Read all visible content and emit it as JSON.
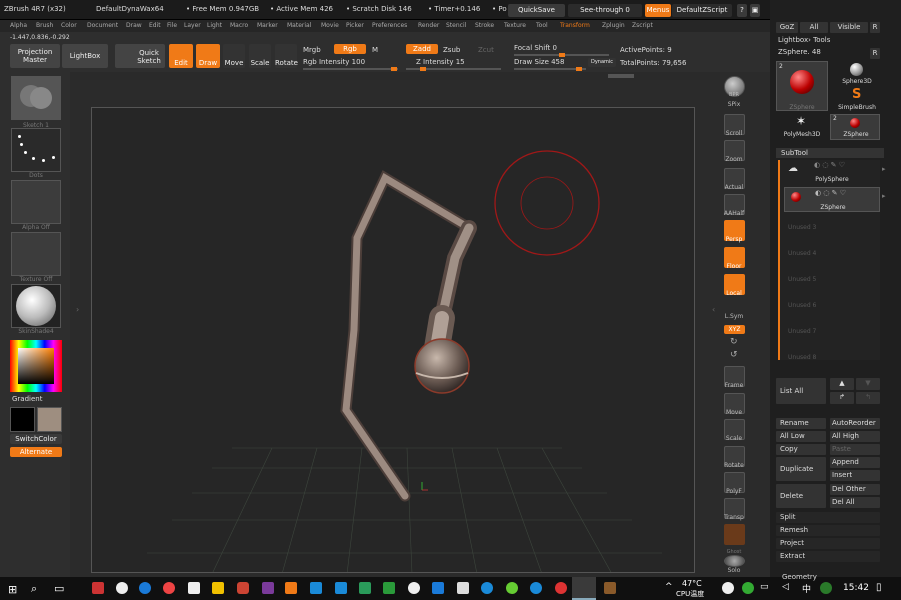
{
  "titlebar": {
    "app": "ZBrush 4R7 (x32)",
    "doc": "DefaultDynaWax64",
    "free_mem": "• Free Mem 0.947GB",
    "active_mem": "• Active Mem 426",
    "scratch": "• Scratch Disk 146",
    "timer": "• Timer+0.146",
    "po": "• Po",
    "quicksave": "QuickSave",
    "seethrough": "See-through  0",
    "menus": "Menus",
    "zscript": "DefaultZScript"
  },
  "menubar": [
    "Alpha",
    "Brush",
    "Color",
    "Document",
    "Draw",
    "Edit",
    "File",
    "Layer",
    "Light",
    "Macro",
    "Marker",
    "Material",
    "Movie",
    "Picker",
    "Preferences",
    "Render",
    "Stencil",
    "Stroke",
    "Texture",
    "Tool",
    "Transform",
    "Zplugin",
    "Zscript"
  ],
  "coords": "-1.447,0.836,-0.292",
  "toolbar": {
    "projection_master": "Projection Master",
    "lightbox": "LightBox",
    "quick_sketch": "Quick Sketch",
    "edit": "Edit",
    "draw": "Draw",
    "move": "Move",
    "scale": "Scale",
    "rotate": "Rotate",
    "mrgb": "Mrgb",
    "rgb": "Rgb",
    "m": "M",
    "zadd": "Zadd",
    "zsub": "Zsub",
    "zcut": "Zcut",
    "rgb_intensity": "Rgb Intensity 100",
    "z_intensity": "Z Intensity 15",
    "focal_shift": "Focal Shift 0",
    "draw_size": "Draw Size 458",
    "dynamic": "Dynamic",
    "active_points": "ActivePoints: 9",
    "total_points": "TotalPoints: 79,656"
  },
  "leftpanel": {
    "sketch": "Sketch 1",
    "dots": "Dots",
    "alpha": "Alpha Off",
    "texture": "Texture Off",
    "material": "SkinShade4",
    "gradient": "Gradient",
    "switchcolor": "SwitchColor",
    "alternate": "Alternate"
  },
  "rightstrip": [
    "BPR",
    "SPix",
    "Scroll",
    "Zoom",
    "Actual",
    "AAHalf",
    "Persp",
    "Floor",
    "Local",
    "L.Sym",
    "XYZ",
    "Frame",
    "Move",
    "Scale",
    "Rotate",
    "PolyF",
    "Transp",
    "Ghost",
    "Solo"
  ],
  "rightpanel": {
    "goz": "GoZ",
    "all": "All",
    "visible": "Visible",
    "r": "R",
    "lightbox_tools": "Lightbox› Tools",
    "zsphere_48": "ZSphere. 48",
    "tools": [
      "ZSphere",
      "Sphere3D",
      "SimpleBrush",
      "PolyMesh3D",
      "ZSphere"
    ],
    "tool_count1": "2",
    "tool_count2": "2",
    "subtool": "SubTool",
    "subtool_items": [
      "PolySphere",
      "ZSphere"
    ],
    "unused": [
      "Unused 3",
      "Unused 4",
      "Unused 5",
      "Unused 6",
      "Unused 7",
      "Unused 8"
    ],
    "list_all": "List All",
    "rename": "Rename",
    "autoreorder": "AutoReorder",
    "all_low": "All Low",
    "all_high": "All High",
    "copy": "Copy",
    "paste": "Paste",
    "duplicate": "Duplicate",
    "append": "Append",
    "insert": "Insert",
    "delete": "Delete",
    "del_other": "Del Other",
    "del_all": "Del All",
    "split": "Split",
    "remesh": "Remesh",
    "project": "Project",
    "extract": "Extract",
    "geometry": "Geometry"
  },
  "taskbar": {
    "temp": "47°C",
    "cpu": "CPU温度",
    "ime": "中",
    "time": "15:42"
  }
}
